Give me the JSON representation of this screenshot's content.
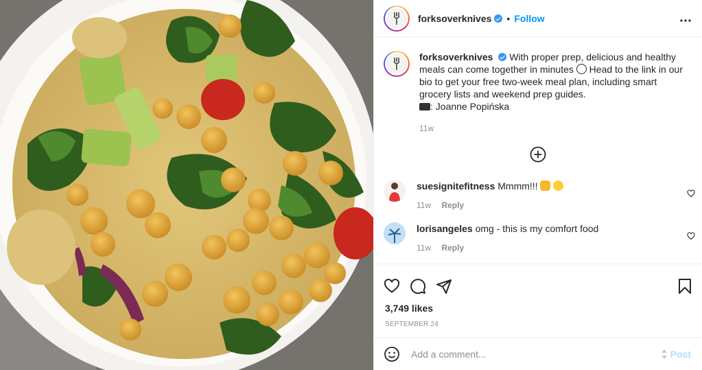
{
  "author": {
    "username": "forksoverknives",
    "follow_label": "Follow",
    "dot": "•"
  },
  "caption": {
    "username": "forksoverknives",
    "text_part1": "With proper prep, delicious and healthy meals can come together in minutes",
    "text_part2": "Head to the link in our bio to get your free two-week meal plan, including smart grocery lists and weekend prep guides.",
    "credit": ": Joanne Popińska",
    "time": "11w"
  },
  "comments": [
    {
      "username": "suesignitefitness",
      "text": "Mmmm!!!",
      "time": "11w",
      "reply_label": "Reply"
    },
    {
      "username": "lorisangeles",
      "text": "omg - this is my comfort food",
      "time": "11w",
      "reply_label": "Reply"
    }
  ],
  "likes": "3,749 likes",
  "date": "SEPTEMBER 24",
  "add_comment": {
    "placeholder": "Add a comment...",
    "post_label": "Post"
  },
  "icons": {
    "more": "more-options-icon",
    "load_more": "plus-circle-icon",
    "like": "heart-icon",
    "comment": "comment-icon",
    "share": "send-icon",
    "save": "bookmark-icon",
    "emoji": "emoji-icon"
  },
  "colors": {
    "accent": "#0095f6",
    "verified": "#3897f0",
    "post_disabled": "#b2dffc"
  }
}
